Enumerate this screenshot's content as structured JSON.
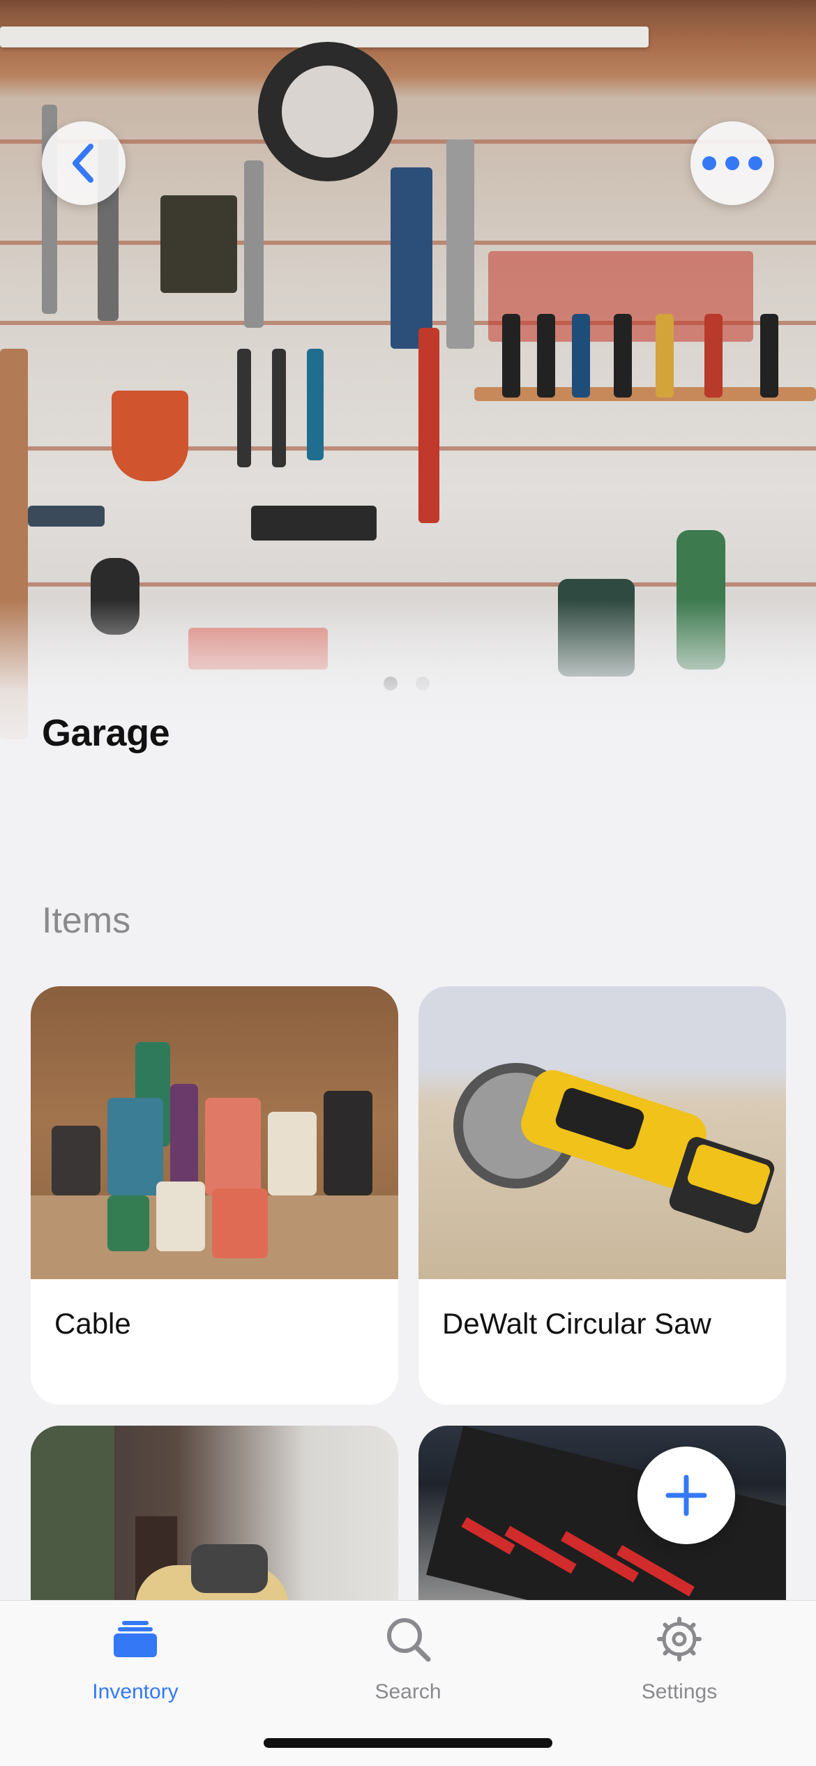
{
  "hero": {
    "title": "Garage",
    "back_icon": "chevron-left-icon",
    "more_icon": "ellipsis-icon",
    "page_dots": 2,
    "active_page": 1
  },
  "sections": {
    "items_title": "Items"
  },
  "items": [
    {
      "name": "Cable",
      "photo": "cable-spools-photo"
    },
    {
      "name": "DeWalt Circular Saw",
      "photo": "circular-saw-photo"
    },
    {
      "name": "",
      "photo": "orbital-sander-photo"
    },
    {
      "name": "",
      "photo": "pliers-drawer-photo"
    }
  ],
  "fab": {
    "icon": "plus-icon"
  },
  "tabbar": {
    "tabs": [
      {
        "label": "Inventory",
        "icon": "tray-stack-icon",
        "active": true
      },
      {
        "label": "Search",
        "icon": "magnifier-icon",
        "active": false
      },
      {
        "label": "Settings",
        "icon": "gear-icon",
        "active": false
      }
    ]
  },
  "colors": {
    "accent": "#3478f6",
    "inactive": "#8a8a8e",
    "background": "#f2f2f4"
  }
}
